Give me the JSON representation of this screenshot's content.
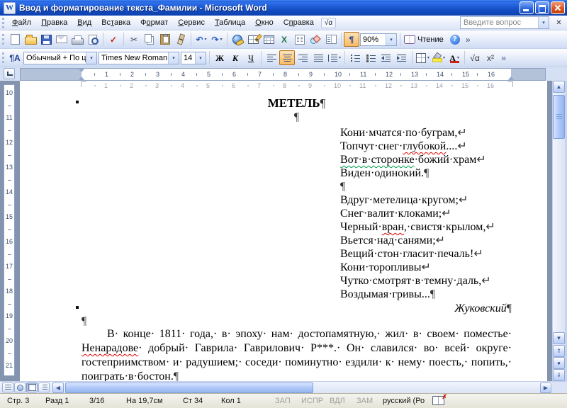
{
  "window": {
    "title": "Ввод и форматирование текста_Фамилии - Microsoft Word",
    "icon_glyph": "W"
  },
  "glyphs": {
    "dropdown": "▾",
    "close": "✕",
    "scroll_up": "▲",
    "scroll_down": "▼",
    "scroll_left": "◀",
    "scroll_right": "▶",
    "browse_prev": "⇑",
    "browse_dot": "●",
    "browse_next": "⇓",
    "spell_x": "✗"
  },
  "menu": {
    "items": [
      {
        "label": "Файл",
        "accel": 0
      },
      {
        "label": "Правка",
        "accel": 0
      },
      {
        "label": "Вид",
        "accel": 0
      },
      {
        "label": "Вставка",
        "accel": 2
      },
      {
        "label": "Формат",
        "accel": 1
      },
      {
        "label": "Сервис",
        "accel": 0
      },
      {
        "label": "Таблица",
        "accel": 0
      },
      {
        "label": "Окно",
        "accel": 0
      },
      {
        "label": "Справка",
        "accel": 1
      }
    ],
    "equation_glyph": "√α",
    "question_placeholder": "Введите вопрос"
  },
  "standard_toolbar": {
    "zoom_value": "90%",
    "reading_label": "Чтение",
    "items": [
      {
        "name": "new-document-button",
        "ic": "new"
      },
      {
        "name": "open-button",
        "ic": "open"
      },
      {
        "name": "save-button",
        "ic": "save"
      },
      {
        "name": "email-button",
        "ic": "mail"
      },
      {
        "name": "print-button",
        "ic": "print"
      },
      {
        "name": "print-preview-button",
        "ic": "preview"
      },
      {
        "sep": true
      },
      {
        "name": "spelling-button",
        "glyph": "✓",
        "color": "#c22010",
        "bold": true
      },
      {
        "sep": true
      },
      {
        "name": "cut-button",
        "glyph": "✂",
        "color": "#3c4656"
      },
      {
        "name": "copy-button",
        "ic": "copy"
      },
      {
        "name": "paste-button",
        "ic": "paste"
      },
      {
        "name": "format-painter-button",
        "ic": "painter"
      },
      {
        "sep": true
      },
      {
        "name": "undo-button",
        "glyph": "↶",
        "color": "#2f62c4",
        "bold": true,
        "arrow": true
      },
      {
        "name": "redo-button",
        "glyph": "↷",
        "color": "#2f62c4",
        "bold": true,
        "arrow": true
      },
      {
        "sep": true
      },
      {
        "name": "insert-hyperlink-button",
        "ic": "link"
      },
      {
        "name": "tables-and-borders-button",
        "ic": "tblb"
      },
      {
        "name": "insert-table-button",
        "ic": "table"
      },
      {
        "name": "insert-excel-sheet-button",
        "glyph": "X",
        "color": "#217346",
        "bold": true
      },
      {
        "name": "columns-button",
        "ic": "cols"
      },
      {
        "name": "drawing-button",
        "ic": "draw"
      },
      {
        "name": "document-map-button",
        "ic": "dmap"
      },
      {
        "sep": true
      },
      {
        "name": "show-hide-formatting-marks-button",
        "glyph": "¶",
        "color": "#1d3f94",
        "bold": true,
        "pressed": true
      },
      {
        "name": "zoom-selector",
        "combo": true,
        "value_key": "zoom_value",
        "w": 52
      },
      {
        "sep": true
      },
      {
        "name": "read-mode-button",
        "ic": "book",
        "label_key": "reading_label"
      },
      {
        "name": "help-button",
        "glyph": "?",
        "helpcircle": true
      },
      {
        "name": "toolbar-options-standard",
        "chevron": true,
        "glyph": "»"
      }
    ]
  },
  "formatting_toolbar": {
    "style_value": "Обычный + По ц",
    "font_value": "Times New Roman",
    "size_value": "14",
    "items": [
      {
        "name": "styles-and-formatting-button",
        "glyph": "¶А",
        "color": "#1d3f94",
        "bold": true
      },
      {
        "name": "style-selector",
        "combo": true,
        "value_key": "style_value",
        "w": 104
      },
      {
        "name": "font-selector",
        "combo": true,
        "value_key": "font_value",
        "w": 114
      },
      {
        "name": "font-size-selector",
        "combo": true,
        "value_key": "size_value",
        "w": 36
      },
      {
        "sep": true
      },
      {
        "name": "bold-button",
        "glyph": "Ж",
        "bold": true,
        "serif": true
      },
      {
        "name": "italic-button",
        "glyph": "К",
        "italic": true,
        "bold": true,
        "serif": true
      },
      {
        "name": "underline-button",
        "glyph": "Ч",
        "underline": true,
        "serif": true
      },
      {
        "sep": true
      },
      {
        "name": "align-left-button",
        "ic": "al"
      },
      {
        "name": "align-center-button",
        "ic": "ac",
        "pressed": true
      },
      {
        "name": "align-right-button",
        "ic": "ar"
      },
      {
        "name": "align-justify-button",
        "ic": "aj"
      },
      {
        "name": "line-spacing-button",
        "ic": "ls",
        "arrow": true
      },
      {
        "sep": true
      },
      {
        "name": "numbered-list-button",
        "ic": "nl"
      },
      {
        "name": "bullet-list-button",
        "ic": "bl"
      },
      {
        "name": "decrease-indent-button",
        "ic": "outd"
      },
      {
        "name": "increase-indent-button",
        "ic": "ind"
      },
      {
        "sep": true
      },
      {
        "name": "borders-button",
        "ic": "bord",
        "arrow": true
      },
      {
        "name": "highlight-button",
        "ic": "hl",
        "arrow": true
      },
      {
        "name": "font-color-button",
        "glyph": "А",
        "bold": true,
        "serif": true,
        "colorbar": "#d02010",
        "arrow": true
      },
      {
        "sep": true
      },
      {
        "name": "equation-editor-button",
        "glyph": "√α",
        "color": "#333333"
      },
      {
        "name": "superscript-button",
        "glyph": "x²",
        "color": "#333333"
      },
      {
        "name": "toolbar-options-formatting",
        "chevron": true,
        "glyph": "»"
      }
    ]
  },
  "ruler": {
    "h_numbers": [
      1,
      2,
      3,
      4,
      5,
      6,
      7,
      8,
      9,
      10,
      11,
      12,
      13,
      14,
      15,
      16
    ],
    "v_numbers": [
      10,
      11,
      12,
      13,
      14,
      15,
      16,
      17,
      18,
      19,
      20,
      21
    ]
  },
  "document": {
    "heading": {
      "text": "МЕТЕЛЬ",
      "mark": "¶"
    },
    "pilcrow_center": "¶",
    "poem": {
      "lines": [
        {
          "segs": [
            {
              "t": "Кони·мчатся·по·буграм,"
            }
          ],
          "end": "↵"
        },
        {
          "segs": [
            {
              "t": "Топчут·снег·"
            },
            {
              "t": "глубокой",
              "wavy": "red"
            },
            {
              "t": "...."
            }
          ],
          "end": "↵"
        },
        {
          "segs": [
            {
              "t": "Вот·в·сторонке",
              "wavy": "green"
            },
            {
              "t": "·божий·храм"
            }
          ],
          "end": "↵"
        },
        {
          "segs": [
            {
              "t": "Виден·одинокий."
            }
          ],
          "end": "¶"
        },
        {
          "segs": [],
          "end": "¶"
        },
        {
          "segs": [
            {
              "t": "Вдруг·метелица·кругом;"
            }
          ],
          "end": "↵"
        },
        {
          "segs": [
            {
              "t": "Снег·валит·клоками;"
            }
          ],
          "end": "↵"
        },
        {
          "segs": [
            {
              "t": "Черный·"
            },
            {
              "t": "вран",
              "wavy": "red"
            },
            {
              "t": ",·свистя·крылом,"
            }
          ],
          "end": "↵"
        },
        {
          "segs": [
            {
              "t": "Вьется·над·санями;"
            }
          ],
          "end": "↵"
        },
        {
          "segs": [
            {
              "t": "Вещий·стон·гласит·печаль!"
            }
          ],
          "end": "↵"
        },
        {
          "segs": [
            {
              "t": "Кони·торопливы"
            }
          ],
          "end": "↵"
        },
        {
          "segs": [
            {
              "t": "Чутко·смотрят·в·темну·даль,"
            }
          ],
          "end": "↵"
        },
        {
          "segs": [
            {
              "t": "Воздымая·гривы..."
            }
          ],
          "end": "¶"
        }
      ]
    },
    "author": {
      "text": "Жуковский",
      "mark": "¶"
    },
    "empty_line_mark": "¶",
    "paragraph": {
      "lines": [
        {
          "indent": true,
          "segs": [
            {
              "t": "В· конце· 1811· года,· в· эпоху· нам· достопамятную,· жил· в· своем· поместье·"
            }
          ]
        },
        {
          "segs": [
            {
              "t": "Ненарадове",
              "wavy": "red"
            },
            {
              "t": "· добрый· Гаврила· Гаврилович· Р***.· Он· славился· во· всей· округе·"
            }
          ]
        },
        {
          "segs": [
            {
              "t": "гостеприимством· и· радушием;· соседи· поминутно· ездили· к· нему· поесть,· попить,·"
            }
          ]
        },
        {
          "last": true,
          "segs": [
            {
              "t": "поиграть·в·бостон."
            }
          ],
          "end": "¶"
        }
      ]
    }
  },
  "status_bar": {
    "items": [
      {
        "label": "Стр. 3"
      },
      {
        "label": "Разд 1"
      },
      {
        "label": "3/16"
      },
      {
        "label": "На 19,7см"
      },
      {
        "label": "Ст 34"
      },
      {
        "label": "Кол 1"
      },
      {
        "label": "ЗАП",
        "dim": true
      },
      {
        "label": "ИСПР",
        "dim": true
      },
      {
        "label": "ВДЛ",
        "dim": true
      },
      {
        "label": "ЗАМ",
        "dim": true
      },
      {
        "label": "русский (Ро"
      }
    ]
  },
  "colors": {
    "titlebar_blue": "#1550c8",
    "pressed_button_orange": "#fbc983",
    "spelling_wavy_red": "#e00000",
    "grammar_wavy_green": "#00a050",
    "toolbar_bg": "#e4ebf9"
  }
}
